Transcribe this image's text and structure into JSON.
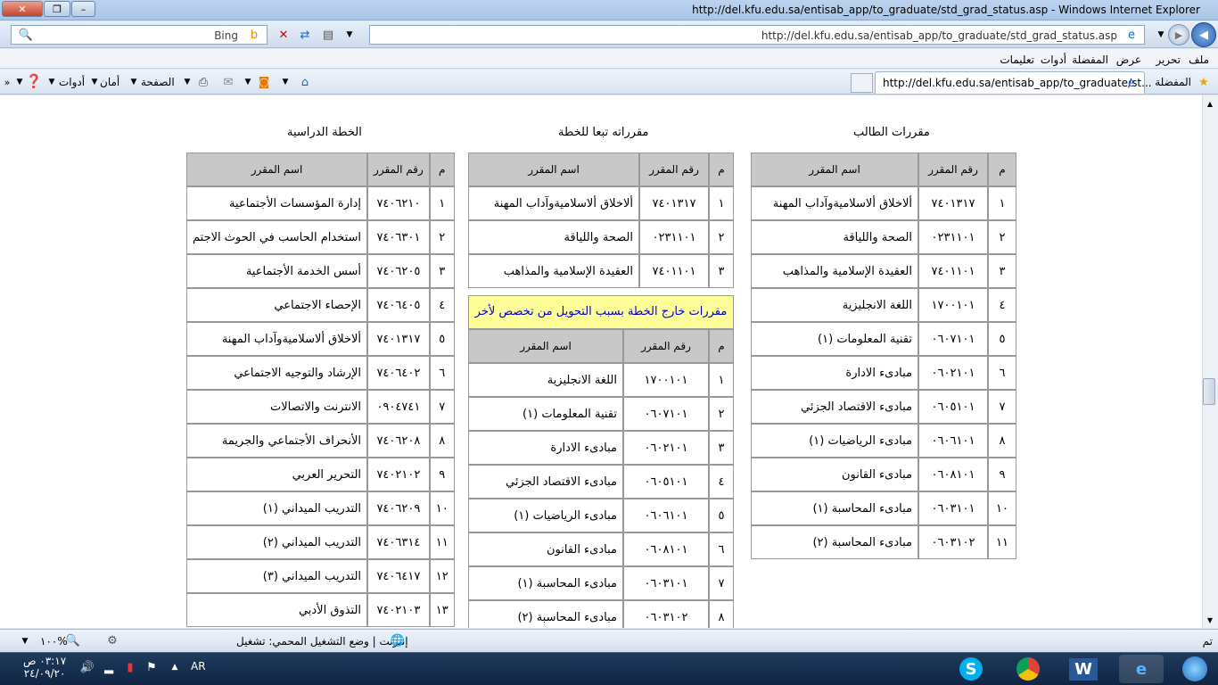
{
  "window": {
    "title": "http://del.kfu.edu.sa/entisab_app/to_graduate/std_grad_status.asp - Windows Internet Explorer"
  },
  "address": {
    "url": "http://del.kfu.edu.sa/entisab_app/to_graduate/std_grad_status.asp"
  },
  "search": {
    "placeholder": "Bing"
  },
  "menu": [
    "ملف",
    "تحرير",
    "عرض",
    "المفضلة",
    "أدوات",
    "تعليمات"
  ],
  "favorites": {
    "label": "المفضلة",
    "tab": "http://del.kfu.edu.sa/entisab_app/to_graduate/st..."
  },
  "commands": {
    "page": "الصفحة",
    "safety": "أمان",
    "tools": "أدوات"
  },
  "headers": {
    "num": "م",
    "code": "رقم المقرر",
    "name": "اسم المقرر"
  },
  "sections": {
    "student": "مقررات الطالب",
    "equivalent": "مقرراته تبعا للخطة",
    "plan": "الخطة الدراسية",
    "outside": "مقررات خارج الخطة بسبب التحويل من تخصص لأخر"
  },
  "student_courses": [
    {
      "n": "١",
      "code": "٧٤٠١٣١٧",
      "name": "ألاخلاق ألاسلاميةوآداب المهنة"
    },
    {
      "n": "٢",
      "code": "٠٢٣١١٠١",
      "name": "الصحة واللياقة"
    },
    {
      "n": "٣",
      "code": "٧٤٠١١٠١",
      "name": "العقيدة الإسلامية والمذاهب"
    },
    {
      "n": "٤",
      "code": "١٧٠٠١٠١",
      "name": "اللغة الانجليزية"
    },
    {
      "n": "٥",
      "code": "٠٦٠٧١٠١",
      "name": "تقنية المعلومات (١)"
    },
    {
      "n": "٦",
      "code": "٠٦٠٢١٠١",
      "name": "مبادىء الادارة"
    },
    {
      "n": "٧",
      "code": "٠٦٠٥١٠١",
      "name": "مبادىء الاقتصاد الجزئي"
    },
    {
      "n": "٨",
      "code": "٠٦٠٦١٠١",
      "name": "مبادىء الرياضيات (١)"
    },
    {
      "n": "٩",
      "code": "٠٦٠٨١٠١",
      "name": "مبادىء القانون"
    },
    {
      "n": "١٠",
      "code": "٠٦٠٣١٠١",
      "name": "مبادىء المحاسبة (١)"
    },
    {
      "n": "١١",
      "code": "٠٦٠٣١٠٢",
      "name": "مبادىء المحاسبة (٢)"
    }
  ],
  "equivalent_courses": [
    {
      "n": "١",
      "code": "٧٤٠١٣١٧",
      "name": "ألاخلاق ألاسلاميةوآداب المهنة"
    },
    {
      "n": "٢",
      "code": "٠٢٣١١٠١",
      "name": "الصحة واللياقة"
    },
    {
      "n": "٣",
      "code": "٧٤٠١١٠١",
      "name": "العقيدة الإسلامية والمذاهب"
    }
  ],
  "outside_courses": [
    {
      "n": "١",
      "code": "١٧٠٠١٠١",
      "name": "اللغة الانجليزية"
    },
    {
      "n": "٢",
      "code": "٠٦٠٧١٠١",
      "name": "تقنية المعلومات (١)"
    },
    {
      "n": "٣",
      "code": "٠٦٠٢١٠١",
      "name": "مبادىء الادارة"
    },
    {
      "n": "٤",
      "code": "٠٦٠٥١٠١",
      "name": "مبادىء الاقتصاد الجزئي"
    },
    {
      "n": "٥",
      "code": "٠٦٠٦١٠١",
      "name": "مبادىء الرياضيات (١)"
    },
    {
      "n": "٦",
      "code": "٠٦٠٨١٠١",
      "name": "مبادىء القانون"
    },
    {
      "n": "٧",
      "code": "٠٦٠٣١٠١",
      "name": "مبادىء المحاسبة (١)"
    },
    {
      "n": "٨",
      "code": "٠٦٠٣١٠٢",
      "name": "مبادىء المحاسبة (٢)"
    }
  ],
  "plan_courses": [
    {
      "n": "١",
      "code": "٧٤٠٦٢١٠",
      "name": "إدارة المؤسسات الأجتماعية"
    },
    {
      "n": "٢",
      "code": "٧٤٠٦٣٠١",
      "name": "استخدام الحاسب في الحوث الاجتم"
    },
    {
      "n": "٣",
      "code": "٧٤٠٦٢٠٥",
      "name": "أسس الخدمة الأجتماعية"
    },
    {
      "n": "٤",
      "code": "٧٤٠٦٤٠٥",
      "name": "الإحصاء الاجتماعي"
    },
    {
      "n": "٥",
      "code": "٧٤٠١٣١٧",
      "name": "ألاخلاق ألاسلاميةوآداب المهنة"
    },
    {
      "n": "٦",
      "code": "٧٤٠٦٤٠٢",
      "name": "الإرشاد والتوجيه الاجتماعي"
    },
    {
      "n": "٧",
      "code": "٠٩٠٤٧٤١",
      "name": "الانترنت والاتصالات"
    },
    {
      "n": "٨",
      "code": "٧٤٠٦٢٠٨",
      "name": "الأنحراف الأجتماعي والجريمة"
    },
    {
      "n": "٩",
      "code": "٧٤٠٢١٠٢",
      "name": "التحرير العربي"
    },
    {
      "n": "١٠",
      "code": "٧٤٠٦٢٠٩",
      "name": "التدريب الميداني (١)"
    },
    {
      "n": "١١",
      "code": "٧٤٠٦٣١٤",
      "name": "التدريب الميداني (٢)"
    },
    {
      "n": "١٢",
      "code": "٧٤٠٦٤١٧",
      "name": "التدريب الميداني (٣)"
    },
    {
      "n": "١٣",
      "code": "٧٤٠٢١٠٣",
      "name": "التذوق الأدبي"
    }
  ],
  "status": {
    "done": "تم",
    "zone": "إنترنت | وضع التشغيل المحمي: تشغيل",
    "zoom": "١٠٠%"
  },
  "taskbar": {
    "lang": "AR",
    "time": "٠٣:١٧ ص",
    "date": "٢٤/٠٩/٢٠"
  },
  "colors": {
    "header": "#c8c8c8",
    "notice_bg": "#ffff99",
    "notice_text": "#0000cc"
  }
}
